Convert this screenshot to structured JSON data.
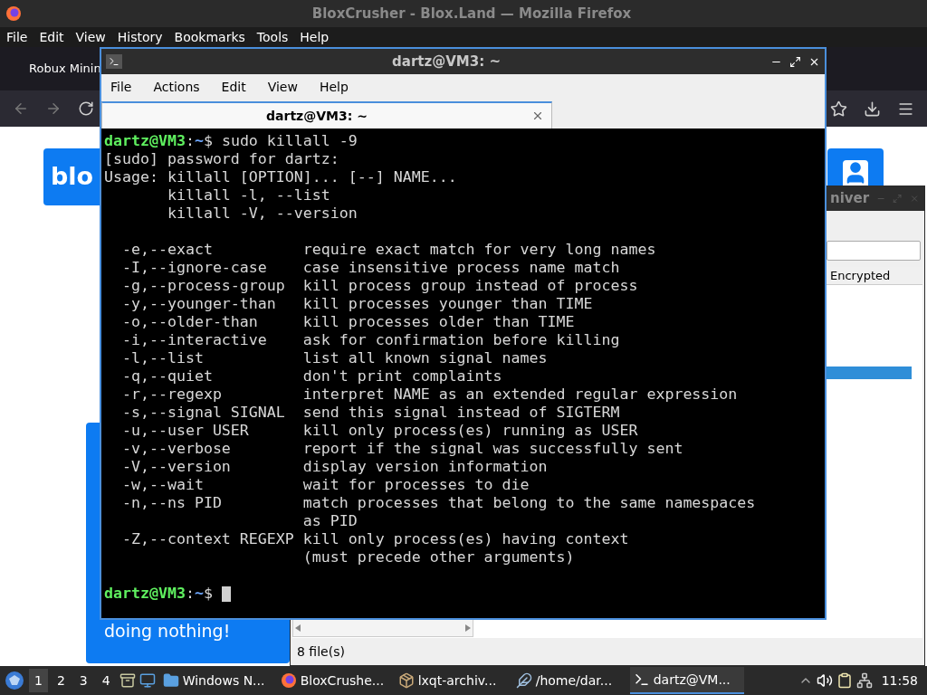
{
  "browser": {
    "title": "BloxCrusher - Blox.Land — Mozilla Firefox",
    "menu": [
      "File",
      "Edit",
      "View",
      "History",
      "Bookmarks",
      "Tools",
      "Help"
    ],
    "tab": "Robux Minin",
    "logo": "blo",
    "card_text": "doing nothing!"
  },
  "archiver": {
    "title": "niver",
    "column": "Encrypted",
    "status": "8 file(s)"
  },
  "terminal": {
    "title": "dartz@VM3: ~",
    "menu": [
      "File",
      "Actions",
      "Edit",
      "View",
      "Help"
    ],
    "tab": "dartz@VM3: ~",
    "lines": [
      {
        "kind": "prompt",
        "user": "dartz@VM3",
        "sep": ":",
        "path": "~",
        "command": "$ sudo killall -9",
        "cursor": false
      },
      {
        "kind": "output",
        "text": "[sudo] password for dartz:"
      },
      {
        "kind": "output",
        "text": "Usage: killall [OPTION]... [--] NAME..."
      },
      {
        "kind": "output",
        "text": "       killall -l, --list"
      },
      {
        "kind": "output",
        "text": "       killall -V, --version"
      },
      {
        "kind": "blank"
      },
      {
        "kind": "output",
        "text": "  -e,--exact          require exact match for very long names"
      },
      {
        "kind": "output",
        "text": "  -I,--ignore-case    case insensitive process name match"
      },
      {
        "kind": "output",
        "text": "  -g,--process-group  kill process group instead of process"
      },
      {
        "kind": "output",
        "text": "  -y,--younger-than   kill processes younger than TIME"
      },
      {
        "kind": "output",
        "text": "  -o,--older-than     kill processes older than TIME"
      },
      {
        "kind": "output",
        "text": "  -i,--interactive    ask for confirmation before killing"
      },
      {
        "kind": "output",
        "text": "  -l,--list           list all known signal names"
      },
      {
        "kind": "output",
        "text": "  -q,--quiet          don't print complaints"
      },
      {
        "kind": "output",
        "text": "  -r,--regexp         interpret NAME as an extended regular expression"
      },
      {
        "kind": "output",
        "text": "  -s,--signal SIGNAL  send this signal instead of SIGTERM"
      },
      {
        "kind": "output",
        "text": "  -u,--user USER      kill only process(es) running as USER"
      },
      {
        "kind": "output",
        "text": "  -v,--verbose        report if the signal was successfully sent"
      },
      {
        "kind": "output",
        "text": "  -V,--version        display version information"
      },
      {
        "kind": "output",
        "text": "  -w,--wait           wait for processes to die"
      },
      {
        "kind": "output",
        "text": "  -n,--ns PID         match processes that belong to the same namespaces"
      },
      {
        "kind": "output",
        "text": "                      as PID"
      },
      {
        "kind": "output",
        "text": "  -Z,--context REGEXP kill only process(es) having context"
      },
      {
        "kind": "output",
        "text": "                      (must precede other arguments)"
      },
      {
        "kind": "blank"
      },
      {
        "kind": "prompt",
        "user": "dartz@VM3",
        "sep": ":",
        "path": "~",
        "command": "$ ",
        "cursor": true
      }
    ]
  },
  "taskbar": {
    "desktops": [
      {
        "label": "1",
        "selected": true
      },
      {
        "label": "2",
        "selected": false
      },
      {
        "label": "3",
        "selected": false
      },
      {
        "label": "4",
        "selected": false
      }
    ],
    "tasks": [
      {
        "kind": "folder",
        "label": "Windows N...",
        "selected": false
      },
      {
        "kind": "firefox",
        "label": "BloxCrushe...",
        "selected": false
      },
      {
        "kind": "archive",
        "label": "lxqt-archiv...",
        "selected": false
      },
      {
        "kind": "editor",
        "label": "/home/dar...",
        "selected": false
      },
      {
        "kind": "terminal",
        "label": "dartz@VM...",
        "selected": true
      }
    ],
    "clock": "11:58"
  }
}
